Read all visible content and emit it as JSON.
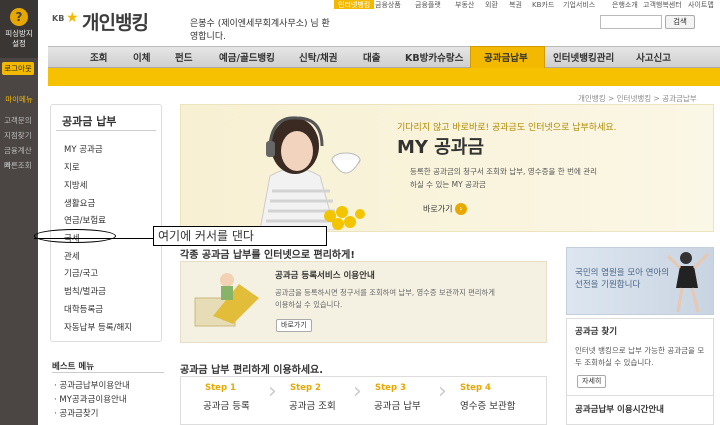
{
  "left_panel": {
    "phishing_label": [
      "피싱방지",
      "설정"
    ],
    "logout": "로그아웃",
    "my_menu": "마이메뉴",
    "sub_items": [
      "고객문의",
      "지점찾기",
      "금융계산기",
      "빠른조회"
    ]
  },
  "header": {
    "kb": "KB",
    "brand": "개인뱅킹",
    "greeting_line1": "은봉수 (제이엔세무회계사무소) 님 환",
    "greeting_line2": "영합니다.",
    "search_button": "검색"
  },
  "top_nav": [
    "인터넷뱅킹",
    "금융상품",
    "금융플랫",
    "부동산",
    "외환",
    "복권",
    "KB카드",
    "기업서비스",
    "은행소개",
    "고객행복센터",
    "사이트맵"
  ],
  "gnb": [
    "조회",
    "이체",
    "펀드",
    "예금/골드뱅킹",
    "신탁/채권",
    "대출",
    "KB방카슈랑스",
    "공과금납부",
    "인터넷뱅킹관리",
    "사고신고"
  ],
  "breadcrumb": "개인뱅킹 > 인터넷뱅킹 > 공과금납부",
  "lnb": {
    "title": "공과금 납부",
    "items": [
      "MY 공과금",
      "지로",
      "지방세",
      "생활요금",
      "연금/보험료",
      "국세",
      "관세",
      "기금/국고",
      "범칙/벌과금",
      "대학등록금",
      "자동납부 등록/해지"
    ]
  },
  "best_menu": {
    "title": "베스트 메뉴",
    "items": [
      "공과금납부이용안내",
      "MY공과금이용안내",
      "공과금찾기"
    ]
  },
  "hero": {
    "subtitle": "기다리지 않고 바로바로! 공과금도 인터넷으로 납부하세요.",
    "title": "MY 공과금",
    "desc": "등록한 공과금의 청구서 조회와 납부, 영수증을 한 번에 관리하실 수 있는 MY 공과금",
    "button": "바로가기"
  },
  "callout": "여기에 커서를 댄다",
  "section1": {
    "title": "각종 공과금 납부를 인터넷으로 편리하게!",
    "reg_title": "공과금 등록서비스 이용안내",
    "reg_desc": "공과금을 등록하시면 청구서를 조회하여 납부, 영수증 보관까지 편리하게 이용하실 수 있습니다.",
    "reg_button": "바로가기"
  },
  "section2": {
    "title": "공과금 납부 편리하게 이용하세요.",
    "steps": [
      {
        "no": "Step 1",
        "label": "공과금 등록"
      },
      {
        "no": "Step 2",
        "label": "공과금 조회"
      },
      {
        "no": "Step 3",
        "label": "공과금 납부"
      },
      {
        "no": "Step 4",
        "label": "영수증 보관함"
      }
    ]
  },
  "right": {
    "banner": "국민의 염원을 모아 연아의 선전을 기원합니다",
    "find_title": "공과금 찾기",
    "find_desc": "인터넷 뱅킹으로 납부 가능한 공과금을 모두 조회하실 수 있습니다.",
    "find_button": "자세히",
    "hours_title": "공과금납부 이용시간안내"
  }
}
